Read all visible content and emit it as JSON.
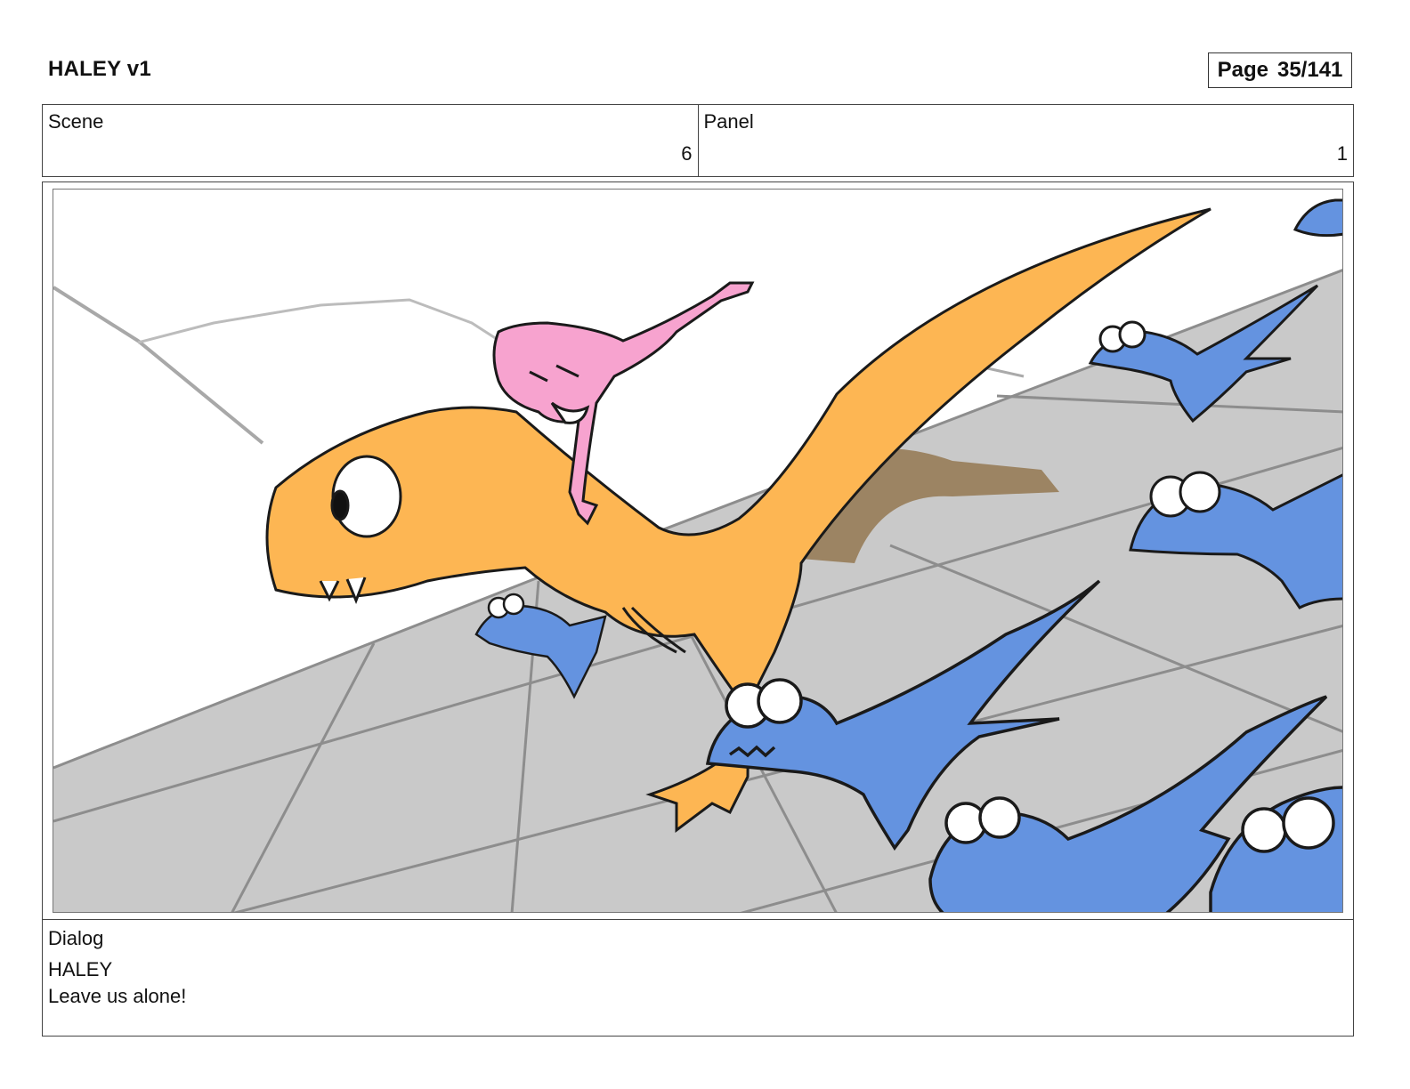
{
  "header": {
    "title": "HALEY v1",
    "page_label": "Page",
    "page_number": "35/141"
  },
  "scene": {
    "label": "Scene",
    "value": "6"
  },
  "panel": {
    "label": "Panel",
    "value": "1"
  },
  "artwork": {
    "colors": {
      "trex": "#fdb653",
      "raptor": "#6493e0",
      "girl": "#f7a3cf",
      "floor": "#c9c9c9",
      "tail_shadow": "#9c8463"
    }
  },
  "dialog": {
    "label": "Dialog",
    "speaker": "HALEY",
    "line": "Leave us alone!"
  }
}
